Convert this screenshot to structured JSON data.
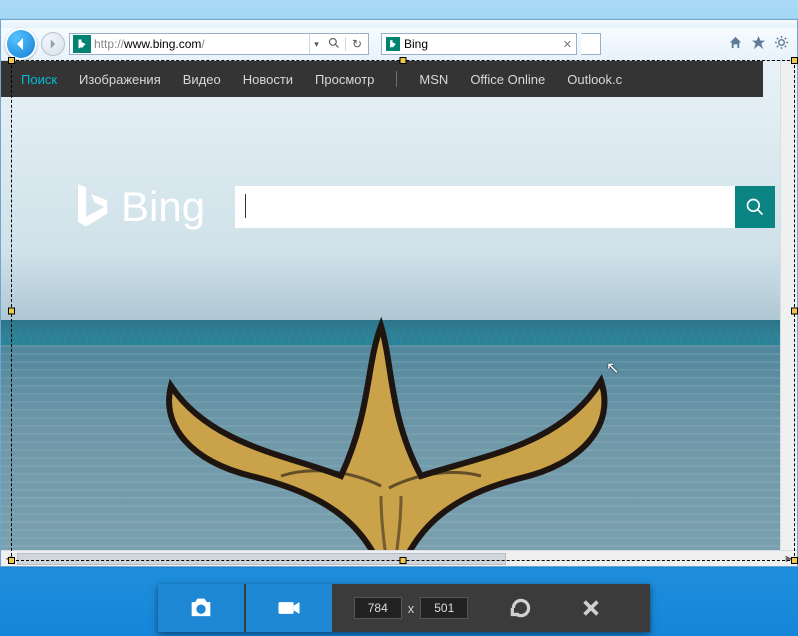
{
  "window_controls": {
    "min": "–",
    "max": "☐",
    "close": "✕"
  },
  "address_bar": {
    "protocol": "http://",
    "domain": "www.bing.com",
    "path": "/",
    "search_glyph": "🔍",
    "dropdown_glyph": "▾",
    "refresh_glyph": "↻"
  },
  "tab": {
    "title": "Bing",
    "close": "✕"
  },
  "ie_icons": {
    "home": "⌂",
    "fav": "★",
    "tools": "⚙"
  },
  "bing_nav": {
    "search": "Поиск",
    "images": "Изображения",
    "video": "Видео",
    "news": "Новости",
    "view": "Просмотр",
    "msn": "MSN",
    "office": "Office Online",
    "outlook": "Outlook.c"
  },
  "bing_logo_text": "Bing",
  "search_value": "",
  "capture": {
    "width": "784",
    "height": "501",
    "sep": "x"
  },
  "scroll_arrows": {
    "left": "◄",
    "right": "►"
  }
}
